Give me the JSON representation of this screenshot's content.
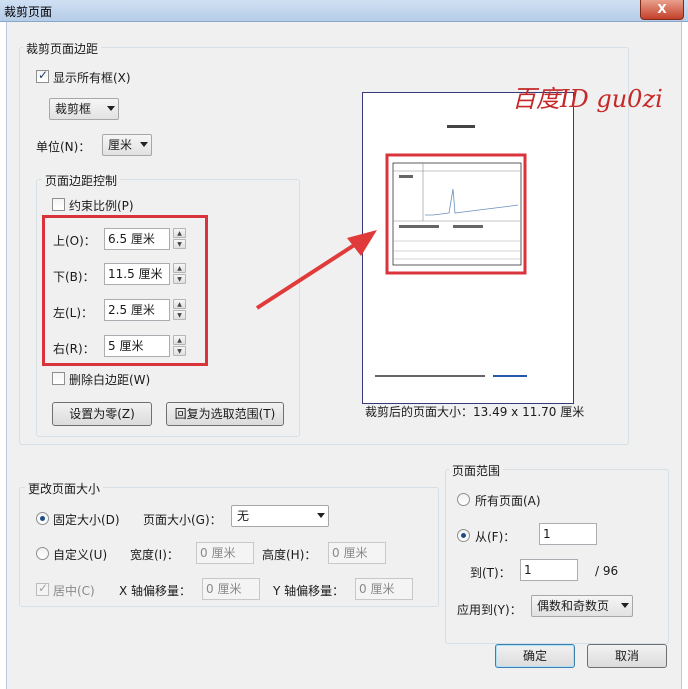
{
  "dialog": {
    "title": "裁剪页面",
    "close_label": "X"
  },
  "margins_group": {
    "title": "裁剪页面边距",
    "show_all_boxes": "显示所有框(X)",
    "box_select": "裁剪框",
    "unit_label": "单位(N)：",
    "unit_value": "厘米",
    "margin_control": {
      "title": "页面边距控制",
      "constrain": "约束比例(P)",
      "top_label": "上(O)：",
      "top_value": "6.5 厘米",
      "bottom_label": "下(B)：",
      "bottom_value": "11.5 厘米",
      "left_label": "左(L)：",
      "left_value": "2.5 厘米",
      "right_label": "右(R)：",
      "right_value": "5 厘米",
      "remove_white": "删除白边距(W)",
      "set_zero": "设置为零(Z)",
      "revert": "回复为选取范围(T)"
    }
  },
  "preview": {
    "caption": "裁剪后的页面大小：13.49 x 11.70 厘米",
    "watermark": "百度ID  gu0zi"
  },
  "page_size_group": {
    "title": "更改页面大小",
    "fixed_size": "固定大小(D)",
    "page_size_label": "页面大小(G)：",
    "page_size_value": "无",
    "custom": "自定义(U)",
    "width_label": "宽度(I)：",
    "width_value": "0 厘米",
    "height_label": "高度(H)：",
    "height_value": "0 厘米",
    "center": "居中(C)",
    "x_offset_label": "X 轴偏移量：",
    "x_offset_value": "0 厘米",
    "y_offset_label": "Y 轴偏移量：",
    "y_offset_value": "0 厘米"
  },
  "page_range_group": {
    "title": "页面范围",
    "all_pages": "所有页面(A)",
    "from_label": "从(F)：",
    "from_value": "1",
    "to_label": "到(T)：",
    "to_value": "1",
    "total": "/ 96",
    "apply_label": "应用到(Y)：",
    "apply_value": "偶数和奇数页"
  },
  "buttons": {
    "ok": "确定",
    "cancel": "取消"
  },
  "colors": {
    "highlight": "#d9343b",
    "accent": "#1c4e86"
  }
}
